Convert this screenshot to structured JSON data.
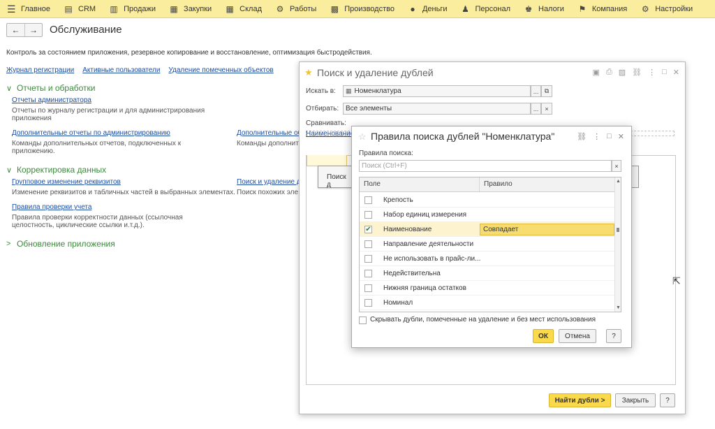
{
  "topmenu": [
    {
      "label": "Главное",
      "icon": "hamburger-icon",
      "glyph": "☰"
    },
    {
      "label": "CRM",
      "icon": "crm-icon",
      "glyph": "▤"
    },
    {
      "label": "Продажи",
      "icon": "sales-icon",
      "glyph": "▥"
    },
    {
      "label": "Закупки",
      "icon": "purchases-icon",
      "glyph": "▦"
    },
    {
      "label": "Склад",
      "icon": "warehouse-icon",
      "glyph": "▦"
    },
    {
      "label": "Работы",
      "icon": "jobs-icon",
      "glyph": "⚙"
    },
    {
      "label": "Производство",
      "icon": "production-icon",
      "glyph": "▩"
    },
    {
      "label": "Деньги",
      "icon": "money-icon",
      "glyph": "●"
    },
    {
      "label": "Персонал",
      "icon": "staff-icon",
      "glyph": "♟"
    },
    {
      "label": "Налоги",
      "icon": "taxes-icon",
      "glyph": "♚"
    },
    {
      "label": "Компания",
      "icon": "company-icon",
      "glyph": "⚑"
    },
    {
      "label": "Настройки",
      "icon": "settings-icon",
      "glyph": "⚙"
    }
  ],
  "page": {
    "back_glyph": "←",
    "forward_glyph": "→",
    "title": "Обслуживание",
    "description": "Контроль за состоянием приложения, резервное копирование и восстановление, оптимизация быстродействия.",
    "quick_links": [
      "Журнал регистрации",
      "Активные пользователи",
      "Удаление помеченных объектов"
    ],
    "sections": {
      "reports": {
        "title": "Отчеты и обработки",
        "chevron": "∨"
      },
      "correction": {
        "title": "Корректировка данных",
        "chevron": "∨"
      },
      "update": {
        "title": "Обновление приложения",
        "chevron": ">"
      }
    },
    "commands": {
      "admin_reports": "Отчеты администратора",
      "admin_reports_desc": "Отчеты по журналу регистрации и для администрирования приложения",
      "extra_reports": "Дополнительные отчеты по администрированию",
      "extra_reports_desc": "Команды дополнительных отчетов, подключенных к приложению.",
      "extra_right": "Дополнительные об",
      "extra_right_desc": "Команды дополните",
      "group_change": "Групповое изменение реквизитов",
      "group_change_desc": "Изменение реквизитов и табличных частей в выбранных элементах.",
      "find_dupes": "Поиск и удаление д",
      "find_dupes_desc": "Поиск похожих эле",
      "check_rules": "Правила проверки учета",
      "check_rules_desc": "Правила проверки корректности данных (ссылочная целостность, циклические ссылки и.т.д.)."
    }
  },
  "dialog_search": {
    "title": "Поиск и удаление дублей",
    "star_glyph": "★",
    "icons": [
      {
        "name": "save-icon",
        "glyph": "▣"
      },
      {
        "name": "print-icon",
        "glyph": "⎙"
      },
      {
        "name": "preview-icon",
        "glyph": "▨"
      },
      {
        "name": "link-icon",
        "glyph": "⛓"
      },
      {
        "name": "more-icon",
        "glyph": "⋮"
      },
      {
        "name": "maximize-icon",
        "glyph": "□"
      },
      {
        "name": "close-icon",
        "glyph": "✕"
      }
    ],
    "search_in_label": "Искать в:",
    "search_in_value": "Номенклатура",
    "filter_label": "Отбирать:",
    "filter_value": "Все элементы",
    "compare_label": "Сравнивать:",
    "compare_link": "Наименование",
    "dots_glyph": "...",
    "open_glyph": "⧉",
    "clear_glyph": "×",
    "search_button_partial": "Поиск д",
    "find_button": "Найти дубли >",
    "close_button": "Закрыть",
    "help_button": "?"
  },
  "dialog_rules": {
    "title": "Правила поиска дублей \"Номенклатура\"",
    "star_glyph": "☆",
    "icons": [
      {
        "name": "link-icon",
        "glyph": "⛓"
      },
      {
        "name": "more-icon",
        "glyph": "⋮"
      },
      {
        "name": "maximize-icon",
        "glyph": "□"
      },
      {
        "name": "close-icon",
        "glyph": "✕"
      }
    ],
    "rules_label": "Правила поиска:",
    "search_placeholder": "Поиск (Ctrl+F)",
    "clear_glyph": "×",
    "columns": [
      "Поле",
      "Правило"
    ],
    "rows": [
      {
        "field": "Крепость",
        "checked": false,
        "rule": ""
      },
      {
        "field": "Набор единиц измерения",
        "checked": false,
        "rule": ""
      },
      {
        "field": "Наименование",
        "checked": true,
        "rule": "Совпадает"
      },
      {
        "field": "Направление деятельности",
        "checked": false,
        "rule": ""
      },
      {
        "field": "Не использовать в прайс-ли...",
        "checked": false,
        "rule": ""
      },
      {
        "field": "Недействительна",
        "checked": false,
        "rule": ""
      },
      {
        "field": "Нижняя граница остатков",
        "checked": false,
        "rule": ""
      },
      {
        "field": "Номинал",
        "checked": false,
        "rule": ""
      }
    ],
    "check_glyph": "✔",
    "scroll_up_glyph": "▲",
    "scroll_down_glyph": "▼",
    "hide_label": "Скрывать дубли, помеченные на удаление и без мест использования",
    "ok_button": "ОК",
    "cancel_button": "Отмена",
    "help_button": "?"
  },
  "cursor_glyph": "⇱"
}
